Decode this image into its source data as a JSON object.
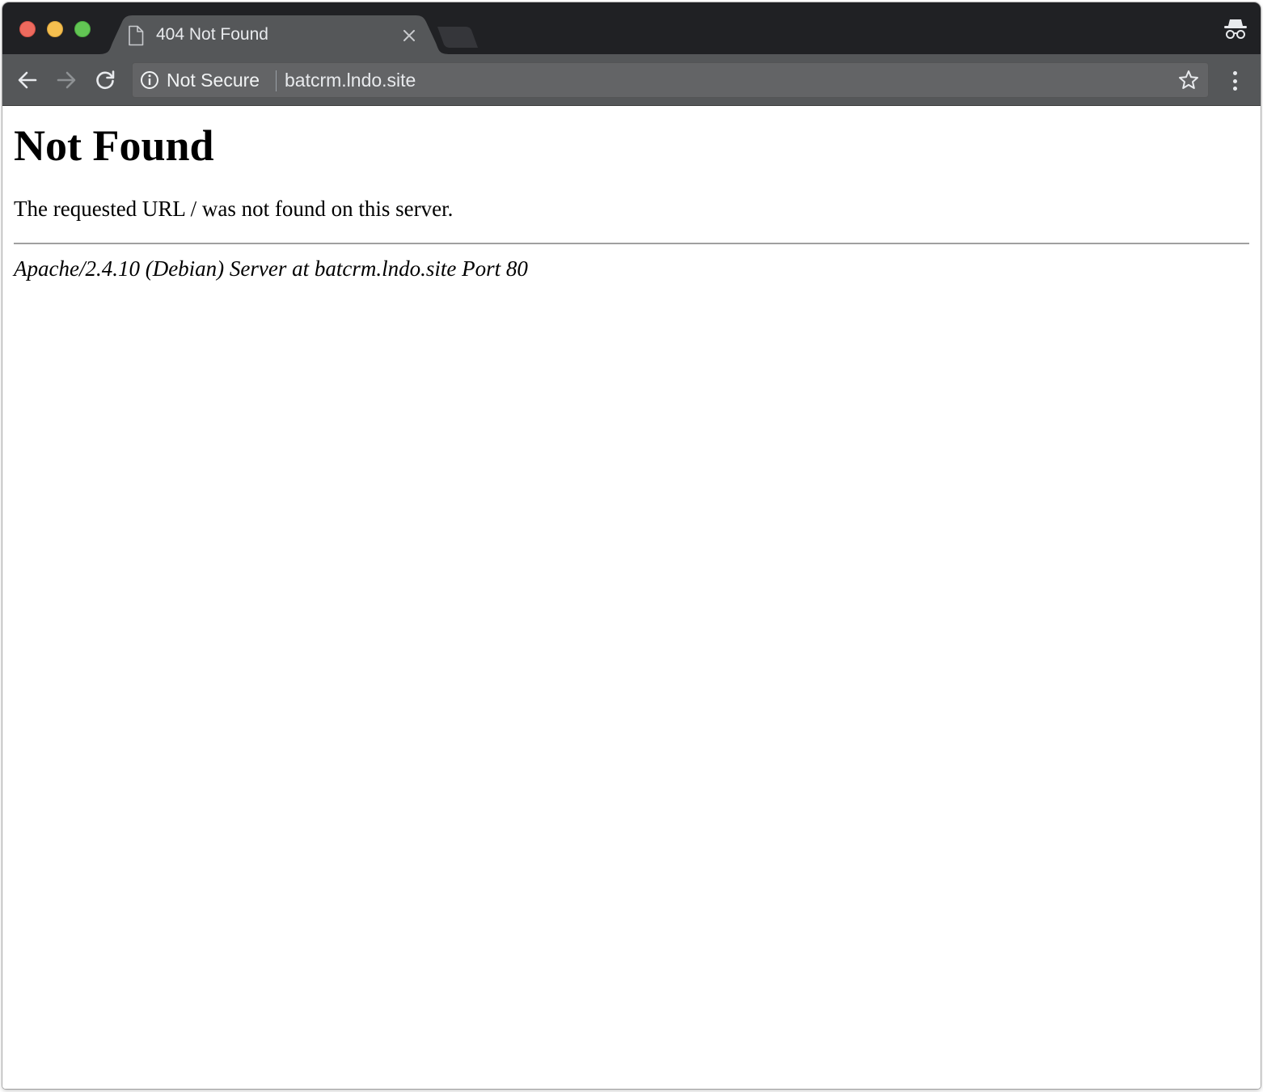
{
  "browser": {
    "tab": {
      "title": "404 Not Found"
    },
    "omnibox": {
      "security_label": "Not Secure",
      "url": "batcrm.lndo.site"
    },
    "icons": {
      "back": "back-arrow-icon",
      "forward": "forward-arrow-icon",
      "reload": "reload-icon",
      "info": "info-icon",
      "star": "star-icon",
      "menu": "more-vert-icon",
      "incognito": "incognito-icon",
      "page": "file-icon",
      "close": "close-icon"
    },
    "colors": {
      "tabstrip": "#202124",
      "active_tab": "#555759",
      "toolbar": "#555759",
      "omnibox": "#636466",
      "traffic_close": "#ed6a5e",
      "traffic_minimize": "#f5bf4f",
      "traffic_maximize": "#62c554"
    }
  },
  "page": {
    "heading": "Not Found",
    "message": "The requested URL / was not found on this server.",
    "server_signature": "Apache/2.4.10 (Debian) Server at batcrm.lndo.site Port 80"
  }
}
